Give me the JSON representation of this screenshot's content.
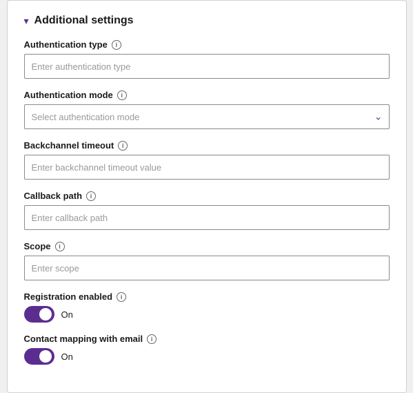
{
  "section": {
    "title": "Additional settings",
    "chevron": "▾"
  },
  "fields": {
    "authentication_type": {
      "label": "Authentication type",
      "placeholder": "Enter authentication type"
    },
    "authentication_mode": {
      "label": "Authentication mode",
      "placeholder": "Select authentication mode",
      "chevron": "∨"
    },
    "backchannel_timeout": {
      "label": "Backchannel timeout",
      "placeholder": "Enter backchannel timeout value"
    },
    "callback_path": {
      "label": "Callback path",
      "placeholder": "Enter callback path"
    },
    "scope": {
      "label": "Scope",
      "placeholder": "Enter scope"
    }
  },
  "toggles": {
    "registration_enabled": {
      "label": "Registration enabled",
      "value_label": "On",
      "checked": true
    },
    "contact_mapping": {
      "label": "Contact mapping with email",
      "value_label": "On",
      "checked": true
    }
  }
}
